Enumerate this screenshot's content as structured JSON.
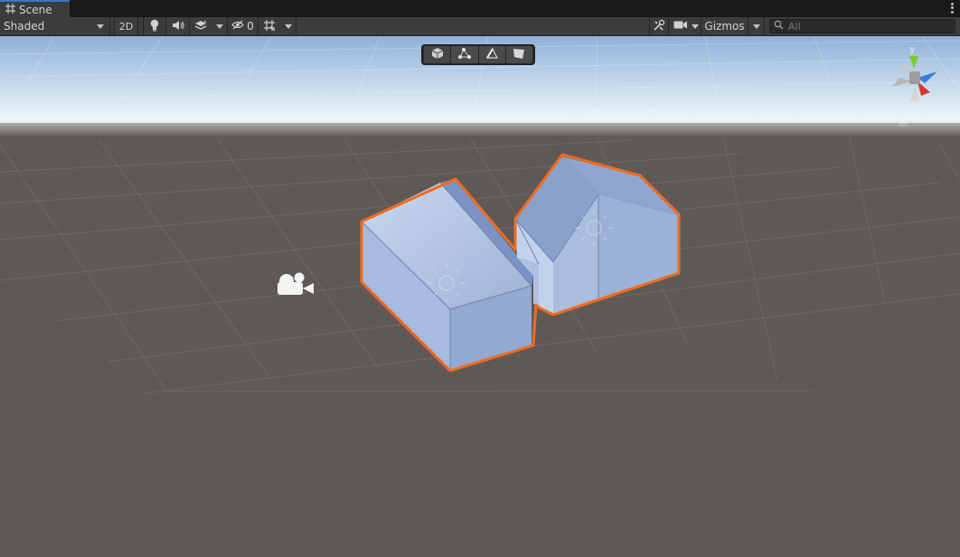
{
  "tab": {
    "title": "Scene",
    "icon": "grid-icon",
    "menu_icon": "kebab-icon"
  },
  "toolbar": {
    "shading_mode": "Shaded",
    "mode_2d_label": "2D",
    "lighting_icon": "lightbulb-icon",
    "audio_icon": "speaker-icon",
    "effects_icon": "layers-icon",
    "hidden_count_icon": "eye-slash-icon",
    "hidden_count": "0",
    "grid_icon": "grid-hash-icon",
    "tools_icon": "wrench-icon",
    "camera_icon": "camera-icon",
    "gizmos_label": "Gizmos",
    "search_placeholder": "All"
  },
  "tool_overlay": {
    "items": [
      {
        "name": "object-mode",
        "icon": "cube-icon"
      },
      {
        "name": "vertex-mode",
        "icon": "vertex-icon"
      },
      {
        "name": "edge-mode",
        "icon": "edge-icon"
      },
      {
        "name": "face-mode",
        "icon": "face-icon"
      }
    ]
  },
  "orientation_gizmo": {
    "y_label": "y",
    "colors": {
      "x": "#d63a2f",
      "y": "#7ccc2d",
      "z": "#3a7fd6"
    }
  },
  "scene": {
    "selection_color": "#f26b1d",
    "mesh_color": "#9fb6dc",
    "ground_color": "#5f5955",
    "sky_color": "#bcd2e8"
  }
}
